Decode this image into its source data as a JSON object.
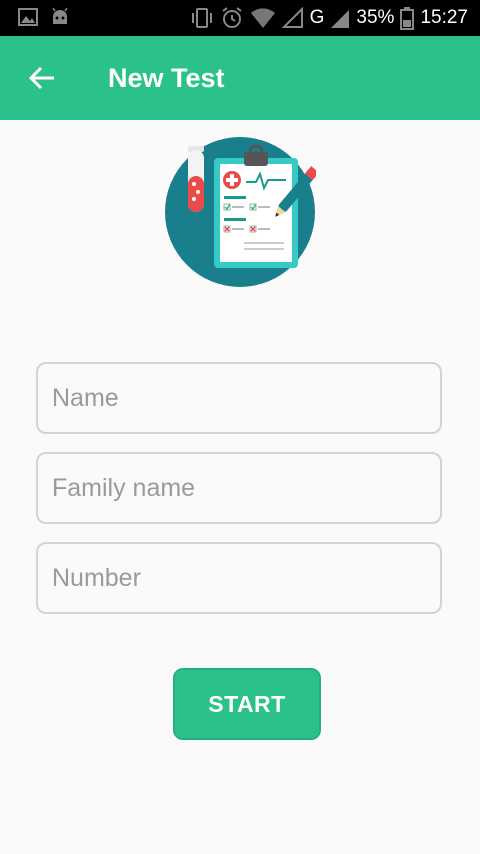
{
  "status_bar": {
    "battery": "35%",
    "network": "G",
    "time": "15:27",
    "left_icons": [
      "image-notification-icon",
      "android-notification-icon"
    ],
    "right_icons": [
      "vibrate-icon",
      "alarm-icon",
      "wifi-icon",
      "signal-icon",
      "battery-icon"
    ]
  },
  "app_bar": {
    "title": "New Test",
    "back_icon": "arrow-back-icon",
    "color": "#2bc18a"
  },
  "illustration": {
    "icon": "medical-clipboard-icon",
    "circle_color": "#1a7f8c"
  },
  "form": {
    "name_placeholder": "Name",
    "family_name_placeholder": "Family name",
    "number_placeholder": "Number"
  },
  "start_button": {
    "label": "START"
  }
}
